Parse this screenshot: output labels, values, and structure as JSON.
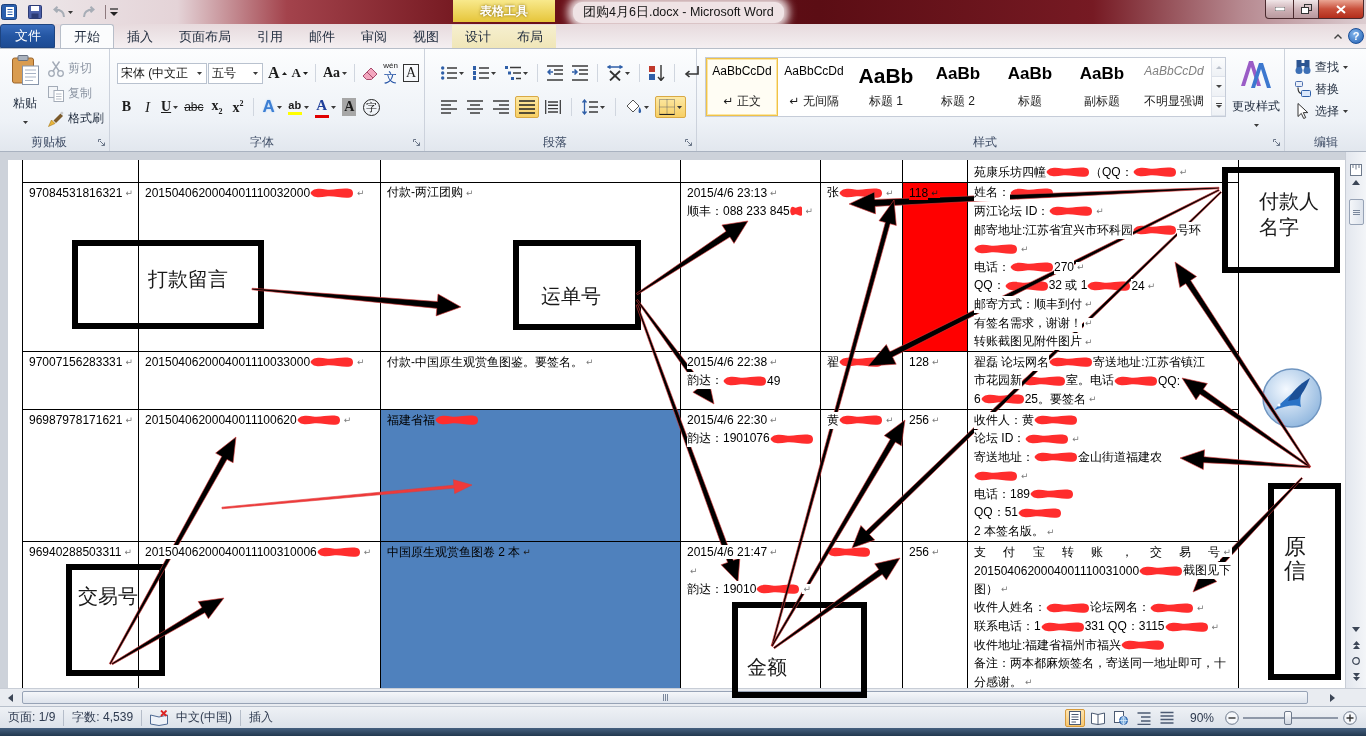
{
  "title_bar": {
    "title": "团购4月6日.docx - Microsoft Word",
    "tool_tab_group": "表格工具"
  },
  "tabs": [
    {
      "label": "文件",
      "kind": "file",
      "selected": false
    },
    {
      "label": "开始",
      "kind": "tab",
      "selected": true
    },
    {
      "label": "插入",
      "kind": "tab",
      "selected": false
    },
    {
      "label": "页面布局",
      "kind": "tab",
      "selected": false
    },
    {
      "label": "引用",
      "kind": "tab",
      "selected": false
    },
    {
      "label": "邮件",
      "kind": "tab",
      "selected": false
    },
    {
      "label": "审阅",
      "kind": "tab",
      "selected": false
    },
    {
      "label": "视图",
      "kind": "tab",
      "selected": false
    },
    {
      "label": "设计",
      "kind": "context",
      "selected": false
    },
    {
      "label": "布局",
      "kind": "context",
      "selected": false
    }
  ],
  "help": "?",
  "ribbon": {
    "clipboard": {
      "title": "剪贴板",
      "paste": "粘贴",
      "commands": [
        {
          "kind": "cut",
          "label": "剪切",
          "disabled": true
        },
        {
          "kind": "copy",
          "label": "复制",
          "disabled": true
        },
        {
          "kind": "format-painter",
          "label": "格式刷",
          "disabled": false
        }
      ]
    },
    "font": {
      "title": "字体",
      "font_name": "宋体 (中文正",
      "font_size": "五号",
      "row_1": [
        {
          "kind": "grow",
          "label": "A",
          "menu": false
        },
        {
          "kind": "shrink",
          "label": "A",
          "menu": false
        },
        {
          "kind": "case",
          "label": "Aa",
          "menu": true
        },
        {
          "kind": "clear",
          "menu": false
        },
        {
          "kind": "phonetic",
          "ruby": "wén",
          "label": "文",
          "menu": false
        },
        {
          "kind": "char-border",
          "label": "A",
          "menu": false
        }
      ],
      "row_2": [
        {
          "kind": "bold",
          "label": "B",
          "menu": false
        },
        {
          "kind": "italic",
          "label": "I",
          "menu": false
        },
        {
          "kind": "underline",
          "label": "U",
          "menu": true
        },
        {
          "kind": "strike",
          "label": "abc",
          "menu": false
        },
        {
          "kind": "subscript",
          "label": "x$_{2}$",
          "menu": false
        },
        {
          "kind": "superscript",
          "label": "x$^{2}$",
          "menu": false
        },
        {
          "kind": "text-effect",
          "label": "A",
          "menu": true
        },
        {
          "kind": "highlight",
          "label": "ab",
          "menu": true,
          "color": "#ffff00"
        },
        {
          "kind": "font-color",
          "label": "A",
          "menu": true,
          "color": "#e00000"
        },
        {
          "kind": "shading",
          "label": "A",
          "menu": false
        },
        {
          "kind": "enclose",
          "label": "字",
          "menu": false
        }
      ]
    },
    "paragraph": {
      "title": "段落",
      "row_1": [
        {
          "kind": "bullets",
          "menu": true
        },
        {
          "kind": "numbering",
          "menu": true
        },
        {
          "kind": "multilevel",
          "menu": true
        },
        {
          "kind": "outdent",
          "menu": false
        },
        {
          "kind": "indent",
          "menu": false
        },
        {
          "kind": "asian-layout",
          "menu": true
        },
        {
          "kind": "sort",
          "menu": false
        },
        {
          "kind": "show-marks",
          "menu": false
        }
      ],
      "row_2": [
        {
          "kind": "align-left",
          "menu": false,
          "selected": false
        },
        {
          "kind": "align-center",
          "menu": false,
          "selected": false
        },
        {
          "kind": "align-right",
          "menu": false,
          "selected": false
        },
        {
          "kind": "justify",
          "menu": false,
          "selected": true
        },
        {
          "kind": "distribute",
          "menu": false,
          "selected": false
        },
        {
          "kind": "line-spacing",
          "menu": true,
          "selected": false
        },
        {
          "kind": "shading",
          "menu": true,
          "selected": false
        },
        {
          "kind": "borders",
          "menu": true,
          "selected": true
        }
      ]
    },
    "styles": {
      "title": "样式",
      "items": [
        {
          "kind": "normal",
          "preview": "AaBbCcDd",
          "label": "↵ 正文",
          "selected": true
        },
        {
          "kind": "no-spacing",
          "preview": "AaBbCcDd",
          "label": "↵ 无间隔",
          "selected": false
        },
        {
          "kind": "heading-1",
          "preview": "AaBb",
          "label": "标题 1",
          "selected": false
        },
        {
          "kind": "heading-2",
          "preview": "AaBb",
          "label": "标题 2",
          "selected": false
        },
        {
          "kind": "title",
          "preview": "AaBb",
          "label": "标题",
          "selected": false
        },
        {
          "kind": "subtitle",
          "preview": "AaBb",
          "label": "副标题",
          "selected": false
        },
        {
          "kind": "subtle-emphasis",
          "preview": "AaBbCcDd",
          "label": "不明显强调",
          "selected": false
        }
      ],
      "change_styles": "更改样式"
    },
    "editing": {
      "title": "编辑",
      "commands": [
        {
          "kind": "find",
          "label": "查找",
          "menu": true
        },
        {
          "kind": "replace",
          "label": "替换",
          "menu": false
        },
        {
          "kind": "select",
          "label": "选择",
          "menu": true
        }
      ]
    }
  },
  "table": {
    "rows": [
      {
        "cells": [
          {},
          {},
          {},
          {},
          {},
          {},
          {
            "lines": [
              [
                {
                  "kind": "text",
                  "text": "苑康乐坊四幢"
                },
                {
                  "kind": "redaction"
                },
                {
                  "kind": "text",
                  "text": "（QQ："
                },
                {
                  "kind": "redaction"
                },
                {
                  "kind": "mark",
                  "text": "↵"
                }
              ]
            ]
          }
        ]
      },
      {
        "cells": [
          {
            "lines": [
              [
                {
                  "kind": "text",
                  "text": "97084531816321"
                },
                {
                  "kind": "mark",
                  "text": "↵"
                }
              ]
            ]
          },
          {
            "lines": [
              [
                {
                  "kind": "text",
                  "text": "2015040620004001110032000"
                },
                {
                  "kind": "redaction"
                },
                {
                  "kind": "mark",
                  "text": "↵"
                }
              ]
            ]
          },
          {
            "lines": [
              [
                {
                  "kind": "text",
                  "text": "付款-两江团购"
                },
                {
                  "kind": "mark",
                  "text": "↵"
                }
              ]
            ]
          },
          {
            "lines": [
              [
                {
                  "kind": "text",
                  "text": "2015/4/6 23:13"
                },
                {
                  "kind": "mark",
                  "text": "↵"
                }
              ],
              [
                {
                  "kind": "text",
                  "text": "顺丰：088 233 845"
                },
                {
                  "kind": "redaction"
                },
                {
                  "kind": "mark",
                  "text": "↵"
                }
              ]
            ]
          },
          {
            "lines": [
              [
                {
                  "kind": "text",
                  "text": "张"
                },
                {
                  "kind": "redaction"
                },
                {
                  "kind": "mark",
                  "text": "↵"
                }
              ]
            ]
          },
          {
            "color": "#ff0000",
            "lines": [
              [
                {
                  "kind": "text",
                  "text": "118"
                },
                {
                  "kind": "mark",
                  "text": "↵"
                }
              ]
            ]
          },
          {
            "lines": [
              [
                {
                  "kind": "text",
                  "text": "姓名："
                },
                {
                  "kind": "redaction"
                }
              ],
              [
                {
                  "kind": "text",
                  "text": "两江论坛 ID："
                },
                {
                  "kind": "redaction"
                },
                {
                  "kind": "mark",
                  "text": "↵"
                }
              ],
              [
                {
                  "kind": "text",
                  "text": "邮寄地址:江苏省宜兴市环科园"
                },
                {
                  "kind": "redaction"
                },
                {
                  "kind": "text",
                  "text": "号环"
                }
              ],
              [
                {
                  "kind": "redaction"
                },
                {
                  "kind": "mark",
                  "text": "↵"
                }
              ],
              [
                {
                  "kind": "text",
                  "text": "电话："
                },
                {
                  "kind": "redaction"
                },
                {
                  "kind": "text",
                  "text": "270"
                },
                {
                  "kind": "mark",
                  "text": "↵"
                }
              ],
              [
                {
                  "kind": "text",
                  "text": "QQ："
                },
                {
                  "kind": "redaction"
                },
                {
                  "kind": "text",
                  "text": "32 或 1"
                },
                {
                  "kind": "redaction"
                },
                {
                  "kind": "text",
                  "text": "24"
                },
                {
                  "kind": "mark",
                  "text": "↵"
                }
              ],
              [
                {
                  "kind": "text",
                  "text": "邮寄方式：顺丰到付"
                },
                {
                  "kind": "mark",
                  "text": "↵"
                }
              ],
              [
                {
                  "kind": "text",
                  "text": "有签名需求，谢谢！"
                },
                {
                  "kind": "mark",
                  "text": "↵"
                }
              ],
              [
                {
                  "kind": "text",
                  "text": "转账截图见附件图片"
                },
                {
                  "kind": "mark",
                  "text": "↵"
                }
              ]
            ]
          }
        ]
      },
      {
        "cells": [
          {
            "lines": [
              [
                {
                  "kind": "text",
                  "text": "97007156283331"
                },
                {
                  "kind": "mark",
                  "text": "↵"
                }
              ]
            ]
          },
          {
            "lines": [
              [
                {
                  "kind": "text",
                  "text": "2015040620004001110033000"
                },
                {
                  "kind": "redaction"
                },
                {
                  "kind": "mark",
                  "text": "↵"
                }
              ]
            ]
          },
          {
            "lines": [
              [
                {
                  "kind": "text",
                  "text": "付款-中国原生观赏鱼图鉴。要签名。"
                },
                {
                  "kind": "mark",
                  "text": "↵"
                }
              ]
            ]
          },
          {
            "lines": [
              [
                {
                  "kind": "text",
                  "text": "2015/4/6 22:38"
                },
                {
                  "kind": "mark",
                  "text": "↵"
                }
              ],
              [
                {
                  "kind": "text",
                  "text": "韵达："
                },
                {
                  "kind": "redaction"
                },
                {
                  "kind": "text",
                  "text": "49"
                }
              ]
            ]
          },
          {
            "lines": [
              [
                {
                  "kind": "text",
                  "text": "翟"
                },
                {
                  "kind": "redaction"
                }
              ]
            ]
          },
          {
            "lines": [
              [
                {
                  "kind": "text",
                  "text": "128"
                },
                {
                  "kind": "mark",
                  "text": "↵"
                }
              ]
            ]
          },
          {
            "lines": [
              [
                {
                  "kind": "text",
                  "text": "翟磊 论坛网名"
                },
                {
                  "kind": "redaction"
                },
                {
                  "kind": "text",
                  "text": "寄送地址:江苏省镇江"
                }
              ],
              [
                {
                  "kind": "text",
                  "text": "市花园新"
                },
                {
                  "kind": "redaction"
                },
                {
                  "kind": "text",
                  "text": "室。电话"
                },
                {
                  "kind": "redaction"
                },
                {
                  "kind": "text",
                  "text": "QQ:"
                }
              ],
              [
                {
                  "kind": "text",
                  "text": "6"
                },
                {
                  "kind": "redaction"
                },
                {
                  "kind": "text",
                  "text": "25。要签名"
                },
                {
                  "kind": "mark",
                  "text": "↵"
                }
              ]
            ]
          }
        ]
      },
      {
        "cells": [
          {
            "lines": [
              [
                {
                  "kind": "text",
                  "text": "96987978171621"
                },
                {
                  "kind": "mark",
                  "text": "↵"
                }
              ]
            ]
          },
          {
            "lines": [
              [
                {
                  "kind": "text",
                  "text": "20150406200040011100620"
                },
                {
                  "kind": "redaction"
                },
                {
                  "kind": "mark",
                  "text": "↵"
                }
              ]
            ]
          },
          {
            "color": "#4f81bd",
            "lines": [
              [
                {
                  "kind": "text",
                  "text": "福建省福"
                },
                {
                  "kind": "redaction"
                }
              ]
            ]
          },
          {
            "lines": [
              [
                {
                  "kind": "text",
                  "text": "2015/4/6 22:30"
                },
                {
                  "kind": "mark",
                  "text": "↵"
                }
              ],
              [
                {
                  "kind": "text",
                  "text": "韵达：1901076"
                },
                {
                  "kind": "redaction"
                }
              ]
            ]
          },
          {
            "lines": [
              [
                {
                  "kind": "text",
                  "text": "黄"
                },
                {
                  "kind": "redaction"
                },
                {
                  "kind": "mark",
                  "text": "↵"
                }
              ]
            ]
          },
          {
            "lines": [
              [
                {
                  "kind": "text",
                  "text": "256"
                },
                {
                  "kind": "mark",
                  "text": "↵"
                }
              ]
            ]
          },
          {
            "lines": [
              [
                {
                  "kind": "text",
                  "text": "收件人：黄"
                },
                {
                  "kind": "redaction"
                }
              ],
              [
                {
                  "kind": "text",
                  "text": "论坛 ID："
                },
                {
                  "kind": "redaction"
                },
                {
                  "kind": "mark",
                  "text": "↵"
                }
              ],
              [
                {
                  "kind": "text",
                  "text": "寄送地址："
                },
                {
                  "kind": "redaction"
                },
                {
                  "kind": "text",
                  "text": "金山街道福建农"
                }
              ],
              [
                {
                  "kind": "redaction"
                },
                {
                  "kind": "mark",
                  "text": "↵"
                }
              ],
              [
                {
                  "kind": "text",
                  "text": "电话：189"
                },
                {
                  "kind": "redaction"
                }
              ],
              [
                {
                  "kind": "text",
                  "text": "QQ：51"
                },
                {
                  "kind": "redaction"
                }
              ],
              [
                {
                  "kind": "text",
                  "text": "2 本签名版。"
                },
                {
                  "kind": "mark",
                  "text": "↵"
                }
              ]
            ]
          }
        ]
      },
      {
        "cells": [
          {
            "lines": [
              [
                {
                  "kind": "text",
                  "text": "96940288503311"
                },
                {
                  "kind": "mark",
                  "text": "↵"
                }
              ]
            ]
          },
          {
            "lines": [
              [
                {
                  "kind": "text",
                  "text": "20150406200040011100310006"
                },
                {
                  "kind": "redaction"
                },
                {
                  "kind": "mark",
                  "text": "↵"
                }
              ]
            ]
          },
          {
            "color": "#4f81bd",
            "lines": [
              [
                {
                  "kind": "text",
                  "text": "中国原生观赏鱼图卷 2 本"
                },
                {
                  "kind": "mark",
                  "text": "↵"
                }
              ]
            ]
          },
          {
            "lines": [
              [
                {
                  "kind": "text",
                  "text": "2015/4/6 21:47"
                },
                {
                  "kind": "mark",
                  "text": "↵"
                }
              ],
              [
                {
                  "kind": "mark",
                  "text": "↵"
                }
              ],
              [
                {
                  "kind": "text",
                  "text": "韵达：19010"
                },
                {
                  "kind": "redaction"
                },
                {
                  "kind": "mark",
                  "text": "↵"
                }
              ]
            ]
          },
          {
            "lines": [
              [
                {
                  "kind": "redaction"
                }
              ]
            ]
          },
          {
            "lines": [
              [
                {
                  "kind": "text",
                  "text": "256"
                },
                {
                  "kind": "mark",
                  "text": "↵"
                }
              ]
            ]
          },
          {
            "lines": [
              [
                {
                  "kind": "spread",
                  "text": "支 付 宝 转 账 ， 交 易 号"
                },
                {
                  "kind": "mark",
                  "text": "↵"
                }
              ],
              [
                {
                  "kind": "text",
                  "text": "2015040620004001110031000"
                },
                {
                  "kind": "redaction"
                },
                {
                  "kind": "text",
                  "text": "截图见下"
                }
              ],
              [
                {
                  "kind": "text",
                  "text": "图）"
                },
                {
                  "kind": "mark",
                  "text": "↵"
                }
              ],
              [
                {
                  "kind": "text",
                  "text": "收件人姓名："
                },
                {
                  "kind": "redaction"
                },
                {
                  "kind": "text",
                  "text": "论坛网名："
                },
                {
                  "kind": "redaction"
                },
                {
                  "kind": "mark",
                  "text": "↵"
                }
              ],
              [
                {
                  "kind": "text",
                  "text": "联系电话：1"
                },
                {
                  "kind": "redaction"
                },
                {
                  "kind": "text",
                  "text": "331 QQ：3115"
                },
                {
                  "kind": "redaction"
                },
                {
                  "kind": "mark",
                  "text": "↵"
                }
              ],
              [
                {
                  "kind": "text",
                  "text": "收件地址:福建省福州市福兴"
                },
                {
                  "kind": "redaction"
                }
              ],
              [
                {
                  "kind": "text",
                  "text": "备注：两本都麻烦签名，寄送同一地址即可，十"
                }
              ],
              [
                {
                  "kind": "text",
                  "text": "分感谢。"
                },
                {
                  "kind": "mark",
                  "text": "↵"
                }
              ]
            ]
          }
        ]
      }
    ]
  },
  "callouts": [
    {
      "label": "付款人名字"
    },
    {
      "label": "打款留言"
    },
    {
      "label": "运单号"
    },
    {
      "label": "原信"
    },
    {
      "label": "交易号"
    },
    {
      "label": "金额"
    }
  ],
  "status_bar": {
    "page": "页面: 1/9",
    "word_count": "字数: 4,539",
    "language": "中文(中国)",
    "mode": "插入",
    "views": [
      {
        "kind": "print-layout",
        "selected": true
      },
      {
        "kind": "reading",
        "selected": false
      },
      {
        "kind": "web",
        "selected": false
      },
      {
        "kind": "outline",
        "selected": false
      },
      {
        "kind": "draft",
        "selected": false
      }
    ],
    "zoom": "90%",
    "zoom_slider": {
      "level": 0.47
    }
  }
}
